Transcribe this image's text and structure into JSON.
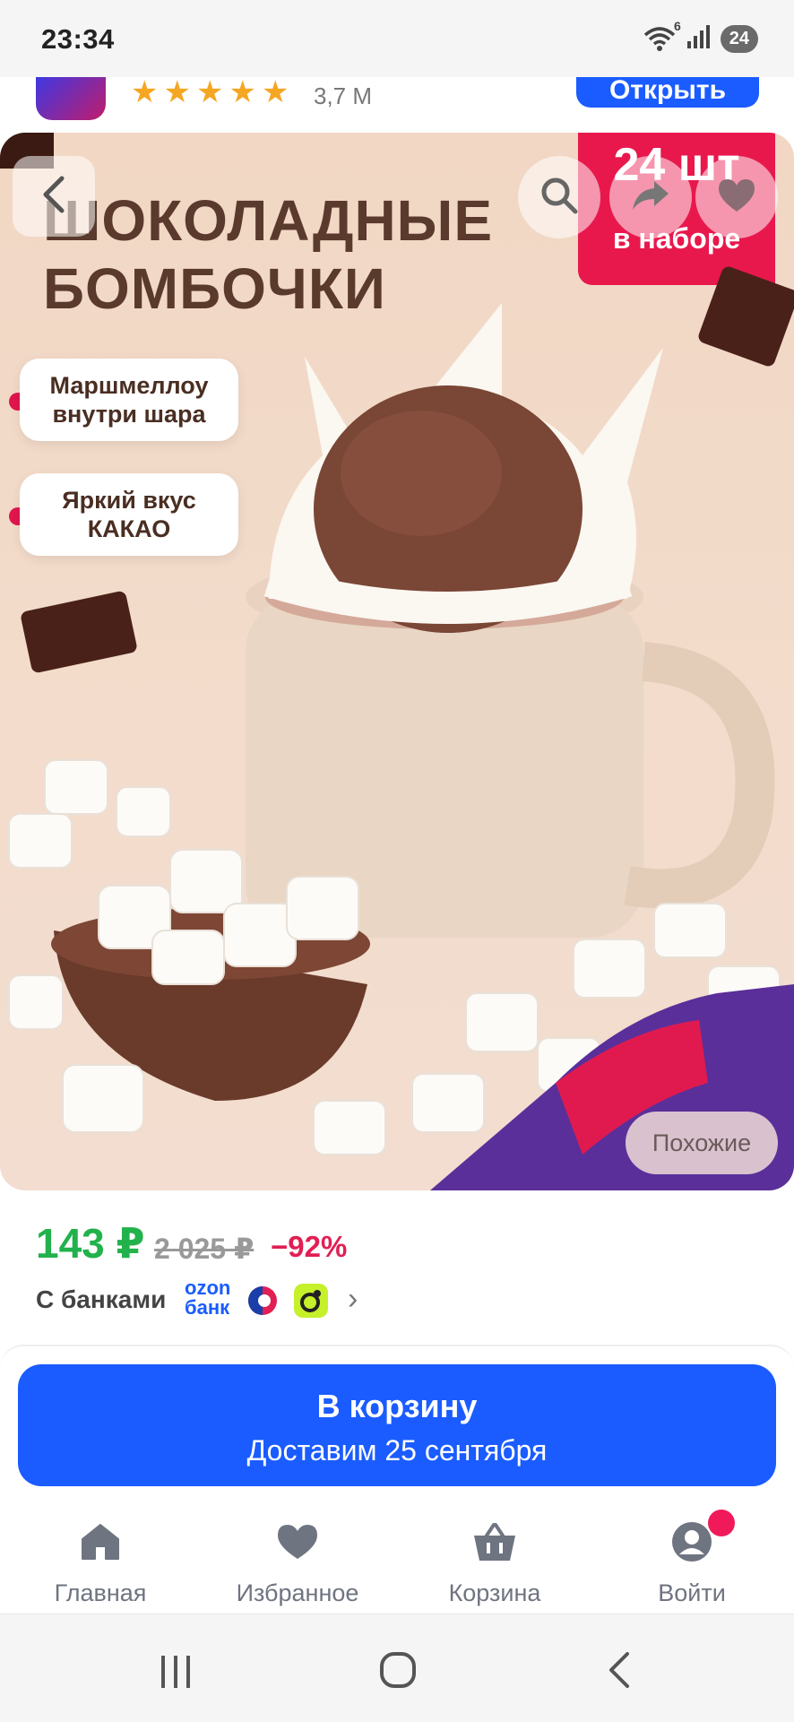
{
  "status_bar": {
    "time": "23:34",
    "battery": "24",
    "wifi_sub": "6"
  },
  "app_banner": {
    "rating_count": "3,7 M",
    "open_label": "Открыть",
    "stars": 5
  },
  "product_image": {
    "title_line1": "ШОКОЛАДНЫЕ",
    "title_line2": "БОМБОЧКИ",
    "set_badge_number": "24 шт",
    "set_badge_text": "в наборе",
    "feature1": "Маршмеллоу внутри шара",
    "feature2": "Яркий вкус КАКАО",
    "similar_label": "Похожие"
  },
  "price": {
    "current": "143 ₽",
    "old": "2 025 ₽",
    "discount": "−92%",
    "banks_label": "С банками",
    "ozon_bank_line1": "ozon",
    "ozon_bank_line2": "банк"
  },
  "cart": {
    "title": "В корзину",
    "delivery": "Доставим 25 сентября"
  },
  "bottom_nav": [
    {
      "label": "Главная",
      "icon": "home-icon"
    },
    {
      "label": "Избранное",
      "icon": "heart-icon"
    },
    {
      "label": "Корзина",
      "icon": "basket-icon"
    },
    {
      "label": "Войти",
      "icon": "profile-icon"
    }
  ],
  "colors": {
    "accent": "#1a5cff",
    "price_green": "#22b24c",
    "discount_red": "#e11f54",
    "badge_red": "#e8184d"
  }
}
